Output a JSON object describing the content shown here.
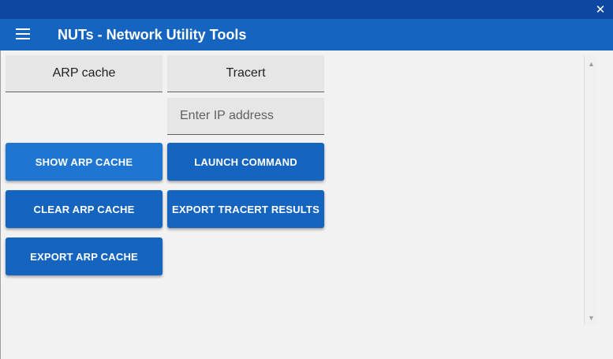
{
  "window": {
    "close_glyph": "✕"
  },
  "appbar": {
    "title": "NUTs - Network Utility Tools",
    "menu_icon": "hamburger-icon"
  },
  "arp": {
    "tab_label": "ARP cache",
    "show_button": "SHOW ARP CACHE",
    "clear_button": "CLEAR ARP CACHE",
    "export_button": "EXPORT ARP CACHE"
  },
  "tracert": {
    "tab_label": "Tracert",
    "input_value": "",
    "input_placeholder": "Enter IP address",
    "launch_button": "LAUNCH COMMAND",
    "export_button": "EXPORT TRACERT RESULTS"
  },
  "scrollbar": {
    "up_glyph": "▲",
    "down_glyph": "▼"
  },
  "colors": {
    "titlebar": "#0d47a1",
    "appbar": "#1565c0",
    "button": "#1565c0",
    "button_active": "#1e76d2",
    "background": "#f2f2f2"
  }
}
